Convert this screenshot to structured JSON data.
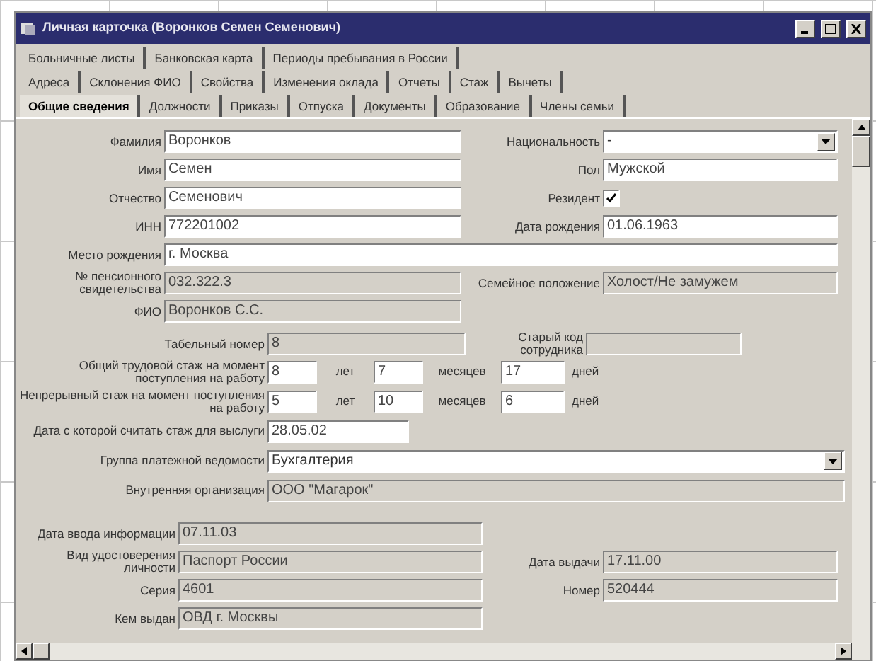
{
  "window": {
    "title": "Личная карточка (Воронков Семен Семенович)"
  },
  "tab_rows": [
    [
      {
        "label": "Больничные листы",
        "selected": false
      },
      {
        "label": "Банковская карта",
        "selected": false
      },
      {
        "label": "Периоды пребывания в России",
        "selected": false
      }
    ],
    [
      {
        "label": "Адреса",
        "selected": false
      },
      {
        "label": "Склонения ФИО",
        "selected": false
      },
      {
        "label": "Свойства",
        "selected": false
      },
      {
        "label": "Изменения оклада",
        "selected": false
      },
      {
        "label": "Отчеты",
        "selected": false
      },
      {
        "label": "Стаж",
        "selected": false
      },
      {
        "label": "Вычеты",
        "selected": false
      }
    ],
    [
      {
        "label": "Общие сведения",
        "selected": true
      },
      {
        "label": "Должности",
        "selected": false
      },
      {
        "label": "Приказы",
        "selected": false
      },
      {
        "label": "Отпуска",
        "selected": false
      },
      {
        "label": "Документы",
        "selected": false
      },
      {
        "label": "Образование",
        "selected": false
      },
      {
        "label": "Члены семьи",
        "selected": false
      }
    ]
  ],
  "personal_rows": [
    {
      "kind": "pair",
      "left": {
        "label": "Фамилия",
        "value": "Воронков",
        "kind": "text",
        "readonly": false
      },
      "right": {
        "label": "Национальность",
        "value": "-",
        "kind": "select",
        "readonly": false
      }
    },
    {
      "kind": "pair",
      "left": {
        "label": "Имя",
        "value": "Семен",
        "kind": "text",
        "readonly": false
      },
      "right": {
        "label": "Пол",
        "value": "Мужской",
        "kind": "text",
        "readonly": false
      }
    },
    {
      "kind": "pair",
      "left": {
        "label": "Отчество",
        "value": "Семенович",
        "kind": "text",
        "readonly": false
      },
      "right": {
        "label": "Резидент",
        "kind": "checkbox",
        "checked": true
      }
    },
    {
      "kind": "pair",
      "left": {
        "label": "ИНН",
        "value": "772201002",
        "kind": "text",
        "readonly": false
      },
      "right": {
        "label": "Дата рождения",
        "value": "01.06.1963",
        "kind": "text",
        "readonly": false
      }
    },
    {
      "kind": "wide",
      "left": {
        "label": "Место рождения",
        "value": "г. Москва",
        "kind": "text",
        "readonly": false
      }
    },
    {
      "kind": "pair",
      "left": {
        "label": "№ пенсионного свидетельства",
        "value": "032.322.3",
        "kind": "text",
        "readonly": true
      },
      "right": {
        "label": "Семейное положение",
        "value": "Холост/Не замужем",
        "kind": "text",
        "readonly": true
      }
    },
    {
      "kind": "pair",
      "left": {
        "label": "ФИО",
        "value": "Воронков С.С.",
        "kind": "text",
        "readonly": true
      }
    }
  ],
  "employee_number": {
    "label": "Табельный номер",
    "value": "8",
    "readonly": true
  },
  "old_code": {
    "label": "Старый код сотрудника",
    "readonly": true
  },
  "experience_rows": [
    {
      "label": "Общий трудовой стаж на момент поступления на работу",
      "years": "8",
      "years_unit": "лет",
      "months": "7",
      "months_unit": "месяцев",
      "days": "17",
      "days_unit": "дней"
    },
    {
      "label": "Непрерывный стаж на момент поступления на работу",
      "years": "5",
      "years_unit": "лет",
      "months": "10",
      "months_unit": "месяцев",
      "days": "6",
      "days_unit": "дней"
    }
  ],
  "employment_rows": [
    {
      "label": "Дата с которой считать стаж для выслуги",
      "value": "28.05.02",
      "kind": "date",
      "readonly": false
    },
    {
      "label": "Группа платежной ведомости",
      "value": "Бухгалтерия",
      "kind": "select",
      "readonly": false
    },
    {
      "label": "Внутренняя организация",
      "value": "ООО \"Магарок\"",
      "kind": "text",
      "readonly": true
    }
  ],
  "document_rows": [
    {
      "kind": "pair",
      "left": {
        "label": "Дата ввода информации",
        "value": "07.11.03",
        "kind": "text",
        "readonly": true
      }
    },
    {
      "kind": "pair",
      "left": {
        "label": "Вид удостоверения личности",
        "value": "Паспорт России",
        "kind": "text",
        "readonly": true
      },
      "right": {
        "label": "Дата выдачи",
        "value": "17.11.00",
        "kind": "text",
        "readonly": true
      }
    },
    {
      "kind": "pair",
      "left": {
        "label": "Серия",
        "value": "4601",
        "kind": "text",
        "readonly": true
      },
      "right": {
        "label": "Номер",
        "value": "520444",
        "kind": "text",
        "readonly": true
      }
    },
    {
      "kind": "pair",
      "left": {
        "label": "Кем выдан",
        "value": "ОВД г. Москвы",
        "kind": "text",
        "readonly": true
      }
    }
  ]
}
